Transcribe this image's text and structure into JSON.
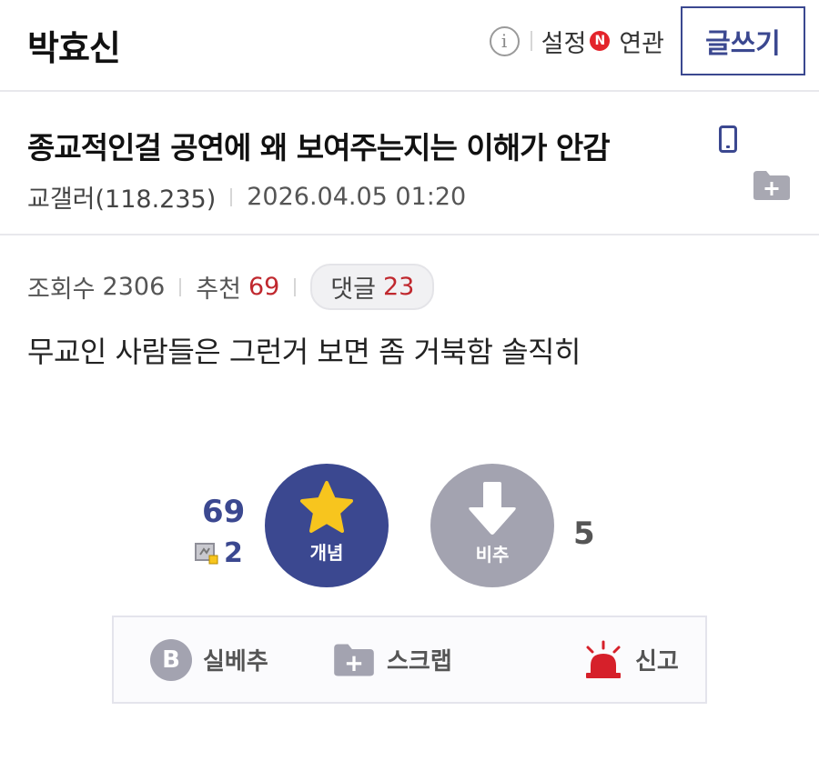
{
  "header": {
    "gallery_name": "박효신",
    "info_icon": "i",
    "settings_label": "설정",
    "new_badge": "N",
    "related_label": "연관",
    "write_button": "글쓰기"
  },
  "post": {
    "title": "종교적인걸 공연에 왜 보여주는지는 이해가 안감",
    "author": "교갤러(118.235)",
    "date": "2026.04.05 01:20",
    "views_label": "조회수",
    "views": "2306",
    "recommend_label": "추천",
    "recommend": "69",
    "comments_label": "댓글",
    "comments": "23",
    "body": "무교인 사람들은 그런거 보면 좀 거북함 솔직히"
  },
  "votes": {
    "up_count": "69",
    "fixed_count": "2",
    "up_label": "개념",
    "down_label": "비추",
    "down_count": "5"
  },
  "actions": {
    "best_icon": "B",
    "best_label": "실베추",
    "scrap_label": "스크랩",
    "report_label": "신고"
  },
  "colors": {
    "accent": "#3b4890",
    "gray_button": "#a3a3b0",
    "red": "#c0282e",
    "star": "#f7c51e"
  },
  "icons": [
    "info-icon",
    "mobile-icon",
    "folder-plus-icon",
    "star-icon",
    "arrow-down-icon",
    "fix-icon",
    "best-b-icon",
    "siren-icon"
  ]
}
